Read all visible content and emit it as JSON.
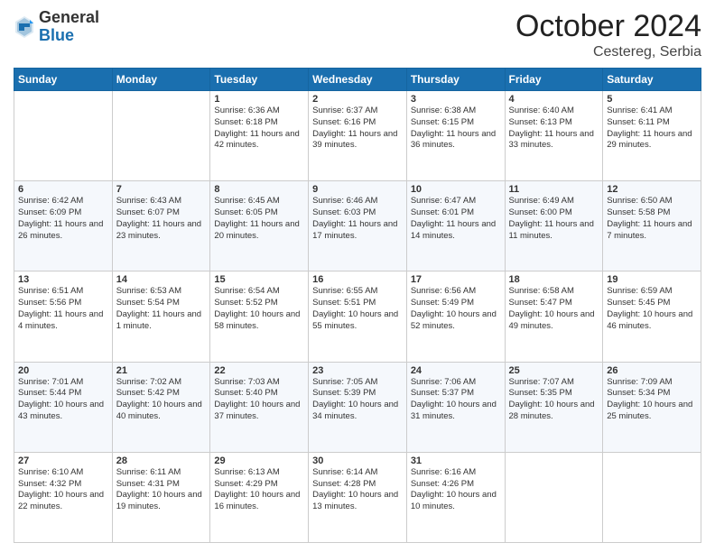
{
  "header": {
    "logo_general": "General",
    "logo_blue": "Blue",
    "title": "October 2024",
    "location": "Cestereg, Serbia"
  },
  "days_of_week": [
    "Sunday",
    "Monday",
    "Tuesday",
    "Wednesday",
    "Thursday",
    "Friday",
    "Saturday"
  ],
  "weeks": [
    [
      {
        "day": "",
        "sunrise": "",
        "sunset": "",
        "daylight": ""
      },
      {
        "day": "",
        "sunrise": "",
        "sunset": "",
        "daylight": ""
      },
      {
        "day": "1",
        "sunrise": "Sunrise: 6:36 AM",
        "sunset": "Sunset: 6:18 PM",
        "daylight": "Daylight: 11 hours and 42 minutes."
      },
      {
        "day": "2",
        "sunrise": "Sunrise: 6:37 AM",
        "sunset": "Sunset: 6:16 PM",
        "daylight": "Daylight: 11 hours and 39 minutes."
      },
      {
        "day": "3",
        "sunrise": "Sunrise: 6:38 AM",
        "sunset": "Sunset: 6:15 PM",
        "daylight": "Daylight: 11 hours and 36 minutes."
      },
      {
        "day": "4",
        "sunrise": "Sunrise: 6:40 AM",
        "sunset": "Sunset: 6:13 PM",
        "daylight": "Daylight: 11 hours and 33 minutes."
      },
      {
        "day": "5",
        "sunrise": "Sunrise: 6:41 AM",
        "sunset": "Sunset: 6:11 PM",
        "daylight": "Daylight: 11 hours and 29 minutes."
      }
    ],
    [
      {
        "day": "6",
        "sunrise": "Sunrise: 6:42 AM",
        "sunset": "Sunset: 6:09 PM",
        "daylight": "Daylight: 11 hours and 26 minutes."
      },
      {
        "day": "7",
        "sunrise": "Sunrise: 6:43 AM",
        "sunset": "Sunset: 6:07 PM",
        "daylight": "Daylight: 11 hours and 23 minutes."
      },
      {
        "day": "8",
        "sunrise": "Sunrise: 6:45 AM",
        "sunset": "Sunset: 6:05 PM",
        "daylight": "Daylight: 11 hours and 20 minutes."
      },
      {
        "day": "9",
        "sunrise": "Sunrise: 6:46 AM",
        "sunset": "Sunset: 6:03 PM",
        "daylight": "Daylight: 11 hours and 17 minutes."
      },
      {
        "day": "10",
        "sunrise": "Sunrise: 6:47 AM",
        "sunset": "Sunset: 6:01 PM",
        "daylight": "Daylight: 11 hours and 14 minutes."
      },
      {
        "day": "11",
        "sunrise": "Sunrise: 6:49 AM",
        "sunset": "Sunset: 6:00 PM",
        "daylight": "Daylight: 11 hours and 11 minutes."
      },
      {
        "day": "12",
        "sunrise": "Sunrise: 6:50 AM",
        "sunset": "Sunset: 5:58 PM",
        "daylight": "Daylight: 11 hours and 7 minutes."
      }
    ],
    [
      {
        "day": "13",
        "sunrise": "Sunrise: 6:51 AM",
        "sunset": "Sunset: 5:56 PM",
        "daylight": "Daylight: 11 hours and 4 minutes."
      },
      {
        "day": "14",
        "sunrise": "Sunrise: 6:53 AM",
        "sunset": "Sunset: 5:54 PM",
        "daylight": "Daylight: 11 hours and 1 minute."
      },
      {
        "day": "15",
        "sunrise": "Sunrise: 6:54 AM",
        "sunset": "Sunset: 5:52 PM",
        "daylight": "Daylight: 10 hours and 58 minutes."
      },
      {
        "day": "16",
        "sunrise": "Sunrise: 6:55 AM",
        "sunset": "Sunset: 5:51 PM",
        "daylight": "Daylight: 10 hours and 55 minutes."
      },
      {
        "day": "17",
        "sunrise": "Sunrise: 6:56 AM",
        "sunset": "Sunset: 5:49 PM",
        "daylight": "Daylight: 10 hours and 52 minutes."
      },
      {
        "day": "18",
        "sunrise": "Sunrise: 6:58 AM",
        "sunset": "Sunset: 5:47 PM",
        "daylight": "Daylight: 10 hours and 49 minutes."
      },
      {
        "day": "19",
        "sunrise": "Sunrise: 6:59 AM",
        "sunset": "Sunset: 5:45 PM",
        "daylight": "Daylight: 10 hours and 46 minutes."
      }
    ],
    [
      {
        "day": "20",
        "sunrise": "Sunrise: 7:01 AM",
        "sunset": "Sunset: 5:44 PM",
        "daylight": "Daylight: 10 hours and 43 minutes."
      },
      {
        "day": "21",
        "sunrise": "Sunrise: 7:02 AM",
        "sunset": "Sunset: 5:42 PM",
        "daylight": "Daylight: 10 hours and 40 minutes."
      },
      {
        "day": "22",
        "sunrise": "Sunrise: 7:03 AM",
        "sunset": "Sunset: 5:40 PM",
        "daylight": "Daylight: 10 hours and 37 minutes."
      },
      {
        "day": "23",
        "sunrise": "Sunrise: 7:05 AM",
        "sunset": "Sunset: 5:39 PM",
        "daylight": "Daylight: 10 hours and 34 minutes."
      },
      {
        "day": "24",
        "sunrise": "Sunrise: 7:06 AM",
        "sunset": "Sunset: 5:37 PM",
        "daylight": "Daylight: 10 hours and 31 minutes."
      },
      {
        "day": "25",
        "sunrise": "Sunrise: 7:07 AM",
        "sunset": "Sunset: 5:35 PM",
        "daylight": "Daylight: 10 hours and 28 minutes."
      },
      {
        "day": "26",
        "sunrise": "Sunrise: 7:09 AM",
        "sunset": "Sunset: 5:34 PM",
        "daylight": "Daylight: 10 hours and 25 minutes."
      }
    ],
    [
      {
        "day": "27",
        "sunrise": "Sunrise: 6:10 AM",
        "sunset": "Sunset: 4:32 PM",
        "daylight": "Daylight: 10 hours and 22 minutes."
      },
      {
        "day": "28",
        "sunrise": "Sunrise: 6:11 AM",
        "sunset": "Sunset: 4:31 PM",
        "daylight": "Daylight: 10 hours and 19 minutes."
      },
      {
        "day": "29",
        "sunrise": "Sunrise: 6:13 AM",
        "sunset": "Sunset: 4:29 PM",
        "daylight": "Daylight: 10 hours and 16 minutes."
      },
      {
        "day": "30",
        "sunrise": "Sunrise: 6:14 AM",
        "sunset": "Sunset: 4:28 PM",
        "daylight": "Daylight: 10 hours and 13 minutes."
      },
      {
        "day": "31",
        "sunrise": "Sunrise: 6:16 AM",
        "sunset": "Sunset: 4:26 PM",
        "daylight": "Daylight: 10 hours and 10 minutes."
      },
      {
        "day": "",
        "sunrise": "",
        "sunset": "",
        "daylight": ""
      },
      {
        "day": "",
        "sunrise": "",
        "sunset": "",
        "daylight": ""
      }
    ]
  ]
}
